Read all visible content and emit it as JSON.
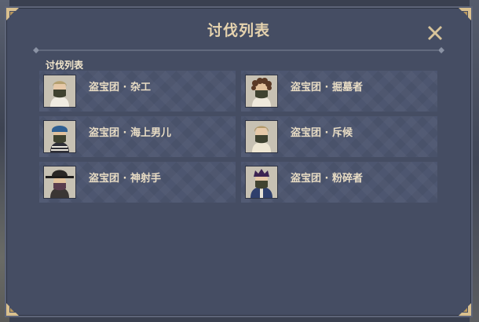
{
  "dialog": {
    "title": "讨伐列表",
    "section_label": "讨伐列表",
    "close_icon": "close-x-icon",
    "accent_color": "#e6d3ae"
  },
  "bounties": [
    {
      "name": "盗宝团 · 杂工",
      "portrait": "hooded-handyman-portrait"
    },
    {
      "name": "盗宝团 · 掘墓者",
      "portrait": "curly-hair-gravedigger-portrait"
    },
    {
      "name": "盗宝团 · 海上男儿",
      "portrait": "bandana-seaman-portrait"
    },
    {
      "name": "盗宝团 · 斥候",
      "portrait": "scout-portrait"
    },
    {
      "name": "盗宝团 · 神射手",
      "portrait": "hat-marksman-portrait"
    },
    {
      "name": "盗宝团 · 粉碎者",
      "portrait": "crusher-portrait"
    }
  ]
}
